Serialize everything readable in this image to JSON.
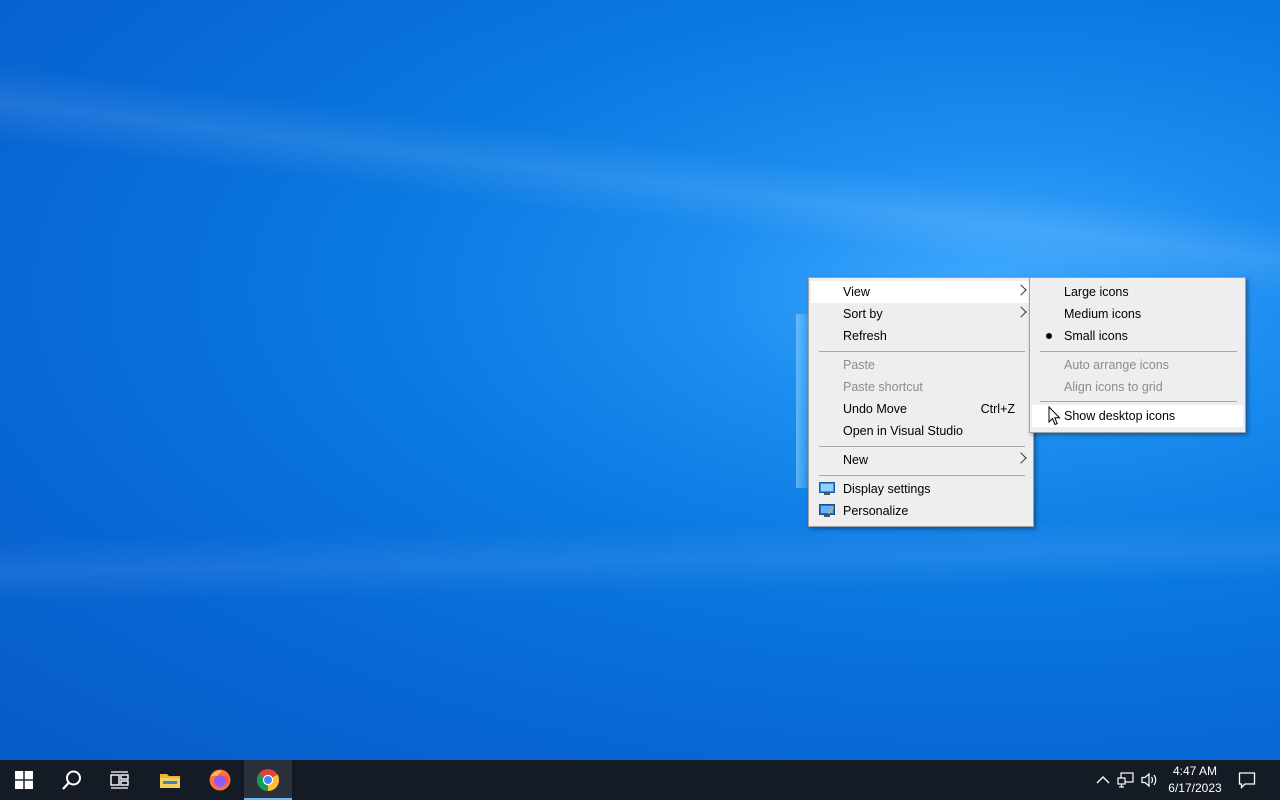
{
  "desktop": {
    "background": "#0a78e0"
  },
  "context_menu": {
    "items": [
      {
        "label": "View",
        "submenu": true,
        "state": "hover"
      },
      {
        "label": "Sort by",
        "submenu": true
      },
      {
        "label": "Refresh"
      },
      {
        "separator": true
      },
      {
        "label": "Paste",
        "disabled": true
      },
      {
        "label": "Paste shortcut",
        "disabled": true
      },
      {
        "label": "Undo Move",
        "shortcut": "Ctrl+Z"
      },
      {
        "label": "Open in Visual Studio"
      },
      {
        "separator": true
      },
      {
        "label": "New",
        "submenu": true
      },
      {
        "separator": true
      },
      {
        "label": "Display settings",
        "icon": "display-icon"
      },
      {
        "label": "Personalize",
        "icon": "personalize-icon"
      }
    ]
  },
  "view_submenu": {
    "items": [
      {
        "label": "Large icons"
      },
      {
        "label": "Medium icons"
      },
      {
        "label": "Small icons",
        "selected": true
      },
      {
        "separator": true
      },
      {
        "label": "Auto arrange icons",
        "disabled": true
      },
      {
        "label": "Align icons to grid",
        "disabled": true
      },
      {
        "separator": true
      },
      {
        "label": "Show desktop icons",
        "state": "hover"
      }
    ]
  },
  "taskbar": {
    "buttons": [
      {
        "name": "start",
        "icon": "windows-logo-icon"
      },
      {
        "name": "search",
        "icon": "search-icon"
      },
      {
        "name": "task-view",
        "icon": "task-view-icon"
      },
      {
        "name": "file-explorer",
        "icon": "folder-icon"
      },
      {
        "name": "firefox",
        "icon": "firefox-icon"
      },
      {
        "name": "chrome",
        "icon": "chrome-icon",
        "active": true
      }
    ],
    "tray": {
      "icons": [
        "chevron-up-icon",
        "network-icon",
        "volume-icon"
      ],
      "time": "4:47 AM",
      "date": "6/17/2023",
      "notification_icon": "notification-icon"
    },
    "background": "#141b24"
  }
}
